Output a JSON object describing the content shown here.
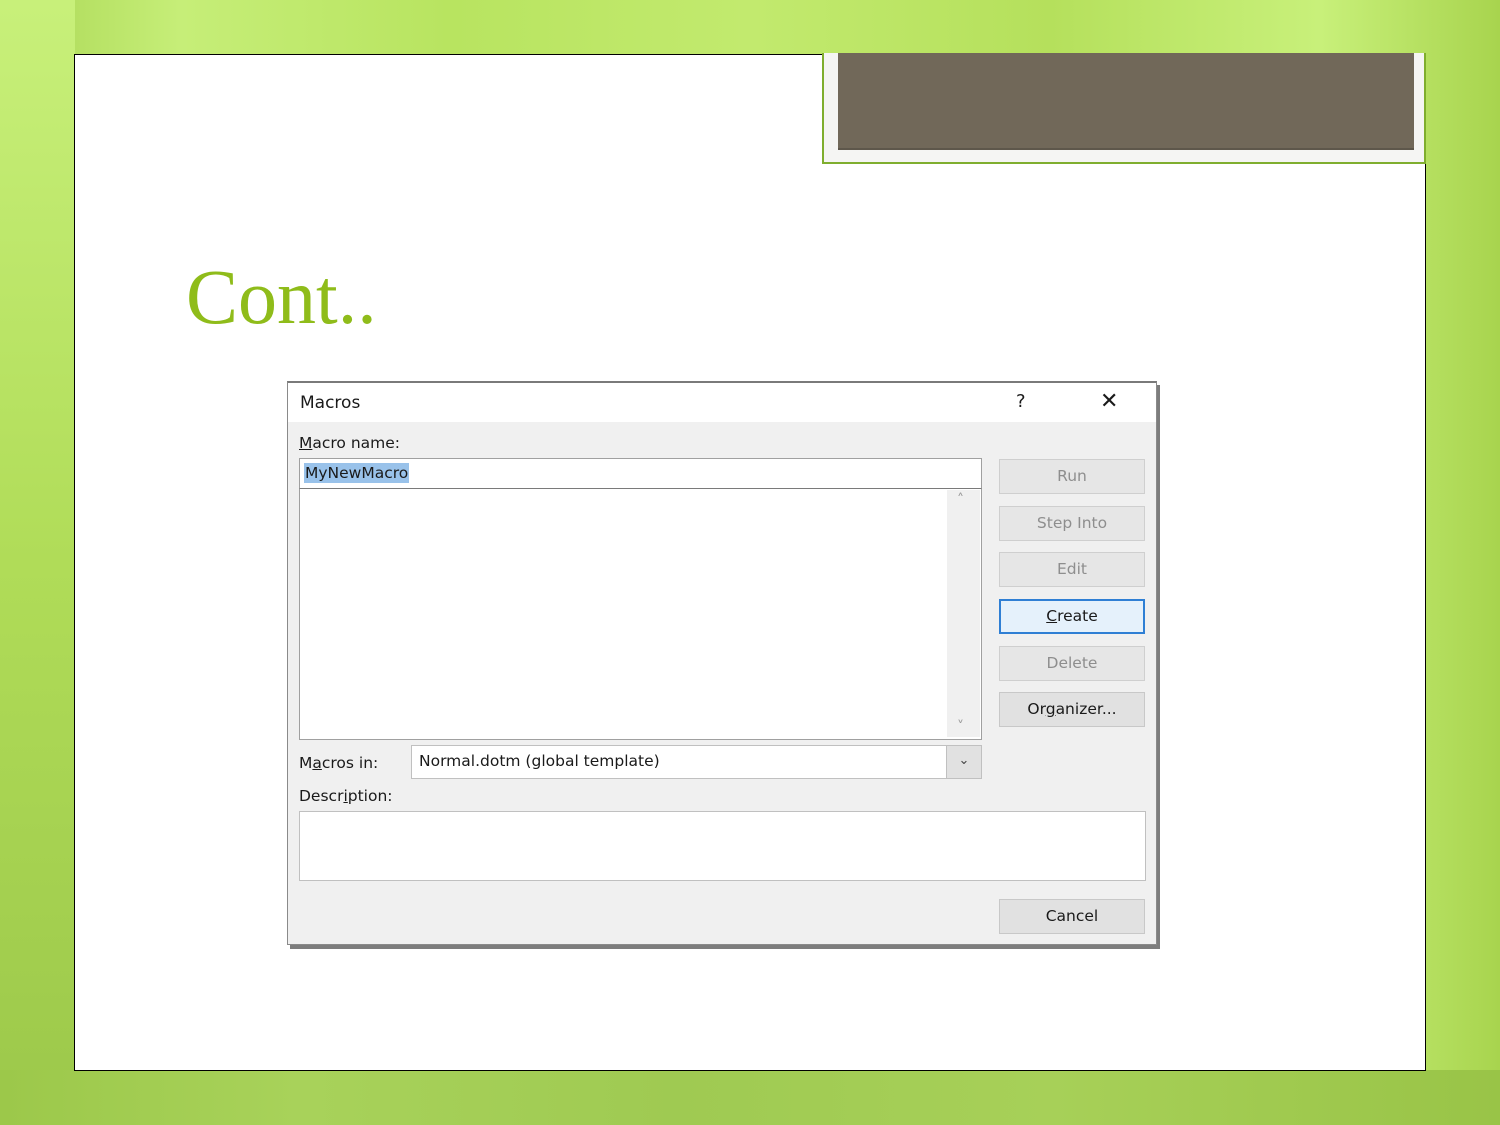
{
  "slide": {
    "title": "Cont.."
  },
  "dialog": {
    "title": "Macros",
    "help_label": "?",
    "close_label": "✕",
    "macro_name_label_u": "M",
    "macro_name_label_rest": "acro name:",
    "macro_name_value": "MyNewMacro",
    "macro_list": [],
    "scroll_up": "˄",
    "scroll_down": "˅",
    "buttons": [
      {
        "label": "Run",
        "state": "disabled"
      },
      {
        "label": "Step Into",
        "state": "disabled"
      },
      {
        "label": "Edit",
        "state": "disabled"
      },
      {
        "label_u": "C",
        "label_rest": "reate",
        "state": "default"
      },
      {
        "label": "Delete",
        "state": "disabled"
      },
      {
        "label_pre": "Or",
        "label_u": "g",
        "label_rest": "anizer...",
        "state": "enabled"
      }
    ],
    "macros_in_label_pre": "M",
    "macros_in_label_u": "a",
    "macros_in_label_rest": "cros in:",
    "macros_in_value": "Normal.dotm (global template)",
    "description_label_pre": "Descr",
    "description_label_u": "i",
    "description_label_rest": "ption:",
    "description_value": "",
    "cancel_label": "Cancel"
  }
}
